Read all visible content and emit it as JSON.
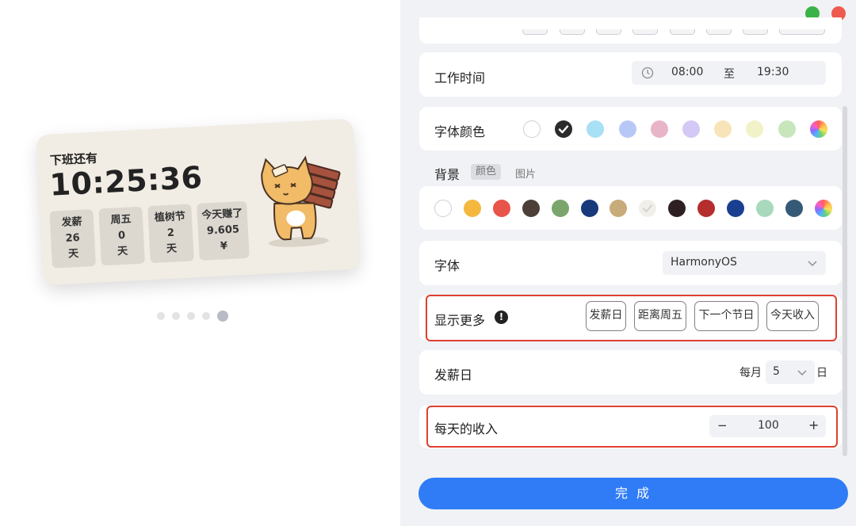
{
  "preview": {
    "widget": {
      "label": "下班还有",
      "time": "10:25:36",
      "stats": [
        {
          "title": "发薪",
          "value": "26",
          "unit": "天"
        },
        {
          "title": "周五",
          "value": "0",
          "unit": "天"
        },
        {
          "title": "植树节",
          "value": "2",
          "unit": "天"
        },
        {
          "title": "今天赚了",
          "value": "9.605",
          "unit": "¥"
        }
      ]
    },
    "pagination": {
      "total": 5,
      "active_index": 5
    }
  },
  "window": {
    "green_button": "#3ab24a",
    "red_button": "#ef5a4f"
  },
  "settings": {
    "work_time": {
      "label": "工作时间",
      "start": "08:00",
      "separator": "至",
      "end": "19:30"
    },
    "font_color": {
      "label": "字体颜色",
      "swatches": [
        "#ffffff",
        "#2b2b2b",
        "#a8e0f5",
        "#b8c8f6",
        "#e8b4c8",
        "#d4c8f6",
        "#f7e4b8",
        "#f1f2c8",
        "#c8e6bc",
        "rainbow"
      ],
      "selected": "#2b2b2b"
    },
    "background": {
      "label": "背景",
      "tab_color": "颜色",
      "tab_image": "图片",
      "swatches": [
        "#ffffff",
        "#f3b83d",
        "#e8544a",
        "#4b3f38",
        "#7aa66c",
        "#173a7a",
        "#c7ab7a",
        "#f1efe9",
        "#2e1f22",
        "#b52d2d",
        "#1a3f91",
        "#a8d9bc",
        "#355a78",
        "rainbow"
      ]
    },
    "font": {
      "label": "字体",
      "value": "HarmonyOS"
    },
    "show_more": {
      "label": "显示更多",
      "info_icon": "!",
      "options": [
        "发薪日",
        "距离周五",
        "下一个节日",
        "今天收入"
      ]
    },
    "payday": {
      "label": "发薪日",
      "prefix": "每月",
      "value": "5",
      "suffix": "日"
    },
    "daily_income": {
      "label": "每天的收入",
      "minus": "−",
      "value": "100",
      "plus": "+"
    },
    "done_label": "完 成",
    "highlight_color": "#e0402f",
    "accent_color": "#2f7cf6"
  }
}
